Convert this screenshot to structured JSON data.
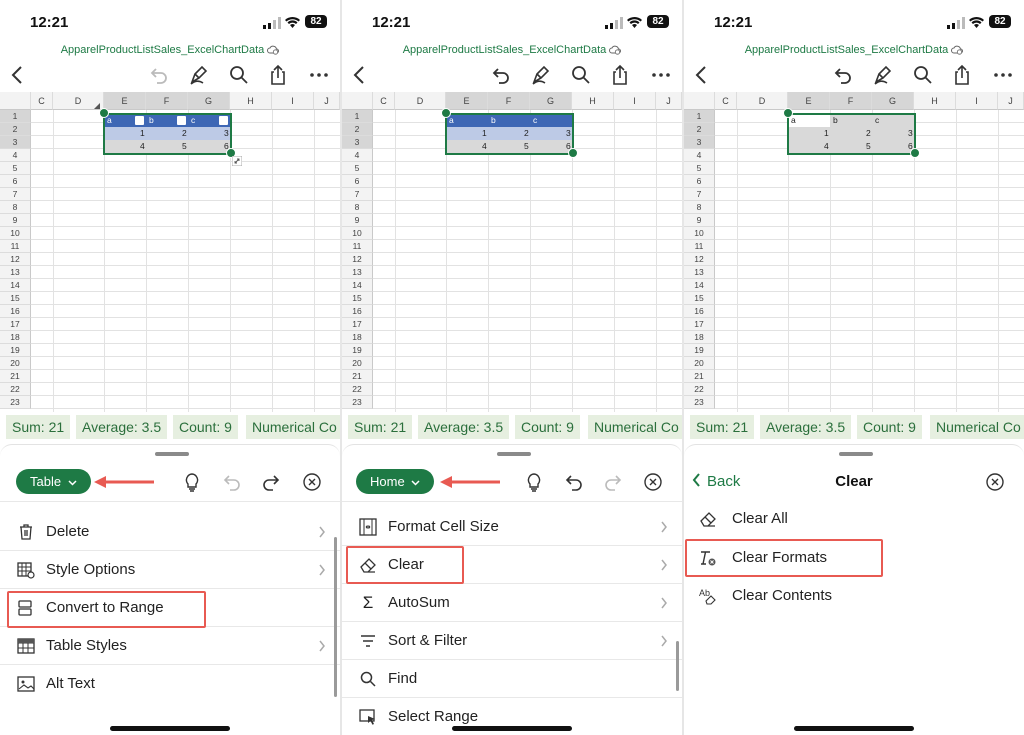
{
  "status": {
    "time": "12:21",
    "battery": "82"
  },
  "filename": "ApparelProductListSales_ExcelChartData",
  "columns": [
    "C",
    "D",
    "E",
    "F",
    "G",
    "H",
    "I",
    "J"
  ],
  "rows": [
    "1",
    "2",
    "3",
    "4",
    "5",
    "6",
    "7",
    "8",
    "9",
    "10",
    "11",
    "12",
    "13",
    "14",
    "15",
    "16",
    "17",
    "18",
    "19",
    "20",
    "21",
    "22",
    "23"
  ],
  "table": {
    "headers": [
      "a",
      "b",
      "c"
    ],
    "row2": [
      "1",
      "2",
      "3"
    ],
    "row3": [
      "4",
      "5",
      "6"
    ]
  },
  "summary": {
    "sum": "Sum: 21",
    "average": "Average: 3.5",
    "count": "Count: 9",
    "numerical": "Numerical Co"
  },
  "panel1": {
    "tab_label": "Table",
    "items": [
      "Delete",
      "Style Options",
      "Convert to Range",
      "Table Styles",
      "Alt Text"
    ]
  },
  "panel2": {
    "tab_label": "Home",
    "items": [
      "Format Cell Size",
      "Clear",
      "AutoSum",
      "Sort & Filter",
      "Find",
      "Select Range"
    ]
  },
  "panel3": {
    "back_label": "Back",
    "title": "Clear",
    "items": [
      "Clear All",
      "Clear Formats",
      "Clear Contents"
    ]
  },
  "colors": {
    "accent": "#1e7a45",
    "highlight": "#e85a52",
    "table_header": "#3e67b5",
    "table_band": "#bdcae6",
    "chip_bg": "#e6efe0"
  }
}
